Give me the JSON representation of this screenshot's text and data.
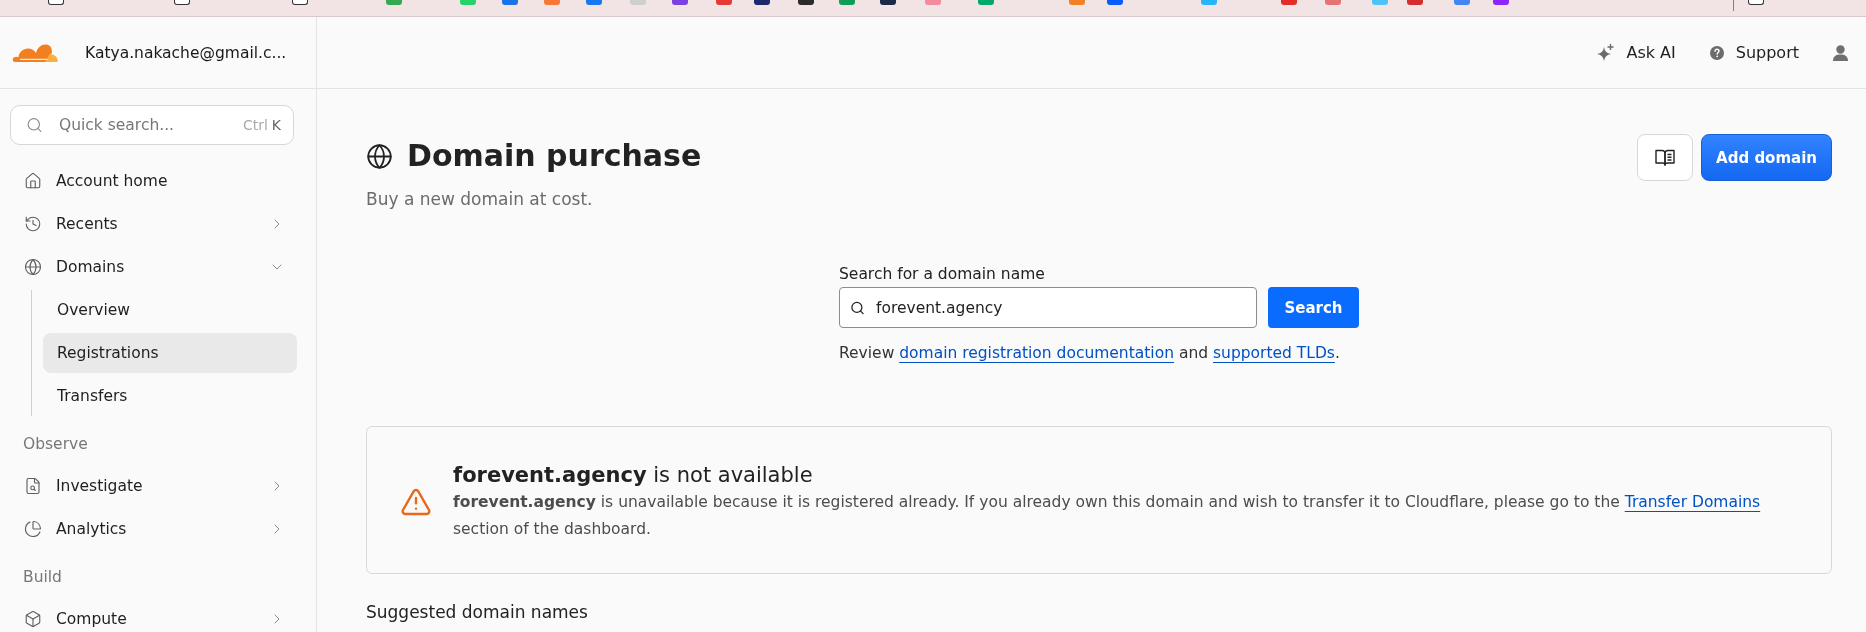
{
  "account": {
    "email": "Katya.nakache@gmail.c..."
  },
  "header": {
    "actions": [
      {
        "kind": "ai",
        "label": "Ask AI"
      },
      {
        "kind": "support",
        "label": "Support"
      }
    ]
  },
  "sidebar": {
    "search": {
      "placeholder": "Quick search...",
      "shortcut": [
        "Ctrl",
        "K"
      ]
    },
    "sections": [
      {
        "items": [
          {
            "label": "Account home",
            "selected": false
          },
          {
            "label": "Recents",
            "selected": false,
            "expanded": false
          },
          {
            "label": "Domains",
            "selected": false,
            "expanded": true,
            "children": [
              {
                "label": "Overview",
                "selected": false
              },
              {
                "label": "Registrations",
                "selected": true
              },
              {
                "label": "Transfers",
                "selected": false
              }
            ]
          }
        ]
      },
      {
        "heading": "Observe",
        "items": [
          {
            "label": "Investigate",
            "selected": false,
            "expanded": false
          },
          {
            "label": "Analytics",
            "selected": false,
            "expanded": false
          }
        ]
      },
      {
        "heading": "Build",
        "items": [
          {
            "label": "Compute",
            "selected": false,
            "expanded": false
          }
        ]
      }
    ]
  },
  "page": {
    "title": "Domain purchase",
    "subtitle": "Buy a new domain at cost.",
    "primary_action": "Add domain"
  },
  "search": {
    "label": "Search for a domain name",
    "value": "forevent.agency",
    "button": "Search",
    "help": [
      {
        "kind": "text",
        "text": "Review "
      },
      {
        "kind": "link",
        "text": "domain registration documentation"
      },
      {
        "kind": "text",
        "text": " and "
      },
      {
        "kind": "link",
        "text": "supported TLDs"
      },
      {
        "kind": "text",
        "text": "."
      }
    ]
  },
  "result": {
    "kind": "warning",
    "title": "**forevent.agency** is not available",
    "message": [
      {
        "kind": "text",
        "text": "**forevent.agency** is unavailable because it is registered already. If you already own this domain and wish to transfer it to Cloudflare, please go to the "
      },
      {
        "kind": "link",
        "text": "Transfer Domains"
      },
      {
        "kind": "text",
        "text": " section of the dashboard."
      }
    ]
  },
  "suggestions": {
    "heading": "Suggested domain names"
  }
}
